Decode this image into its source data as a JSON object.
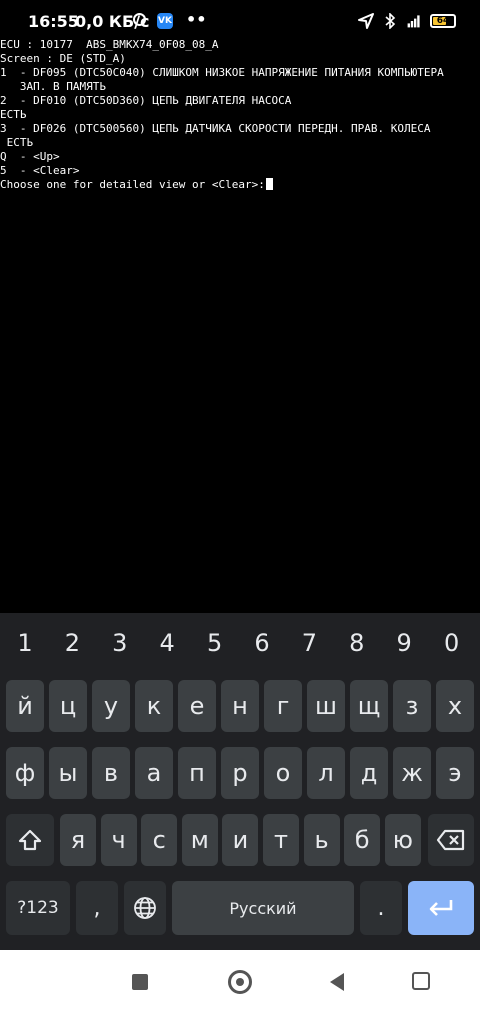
{
  "status_bar": {
    "time": "16:55",
    "speed": "0,0 КБ/с",
    "app_badge": "VK",
    "more": "••",
    "battery_level": "64",
    "battery_percent": 64,
    "accent_battery": "#f6c331"
  },
  "terminal": {
    "lines": [
      "ECU : 10177  ABS_BMKX74_0F08_08_A",
      "Screen : DE (STD_A)",
      "1  - DF095 (DTC50C040) СЛИШКОМ НИЗКОЕ НАПРЯЖЕНИЕ ПИТАНИЯ КОМПЬЮТЕРА",
      "   ЗАП. В ПАМЯТЬ",
      "2  - DF010 (DTC50D360) ЦЕПЬ ДВИГАТЕЛЯ НАСОСА",
      "ЕСТЬ",
      "3  - DF026 (DTC500560) ЦЕПЬ ДАТЧИКА СКОРОСТИ ПЕРЕДН. ПРАВ. КОЛЕСА",
      " ЕСТЬ",
      "Q  - <Up>",
      "5  - <Clear>",
      "Choose one for detailed view or <Clear>:"
    ]
  },
  "keyboard": {
    "numbers": [
      "1",
      "2",
      "3",
      "4",
      "5",
      "6",
      "7",
      "8",
      "9",
      "0"
    ],
    "row1": [
      "й",
      "ц",
      "у",
      "к",
      "е",
      "н",
      "г",
      "ш",
      "щ",
      "з",
      "х"
    ],
    "row2": [
      "ф",
      "ы",
      "в",
      "а",
      "п",
      "р",
      "о",
      "л",
      "д",
      "ж",
      "э"
    ],
    "row3": [
      "я",
      "ч",
      "с",
      "м",
      "и",
      "т",
      "ь",
      "б",
      "ю"
    ],
    "symbols_label": "?123",
    "comma_label": ",",
    "space_label": "Русский",
    "period_label": ".",
    "enter_color": "#8ab4f8"
  },
  "nav": {
    "square": "square-icon",
    "home": "home-icon",
    "back": "back-icon",
    "extra": "screenshot-icon"
  }
}
